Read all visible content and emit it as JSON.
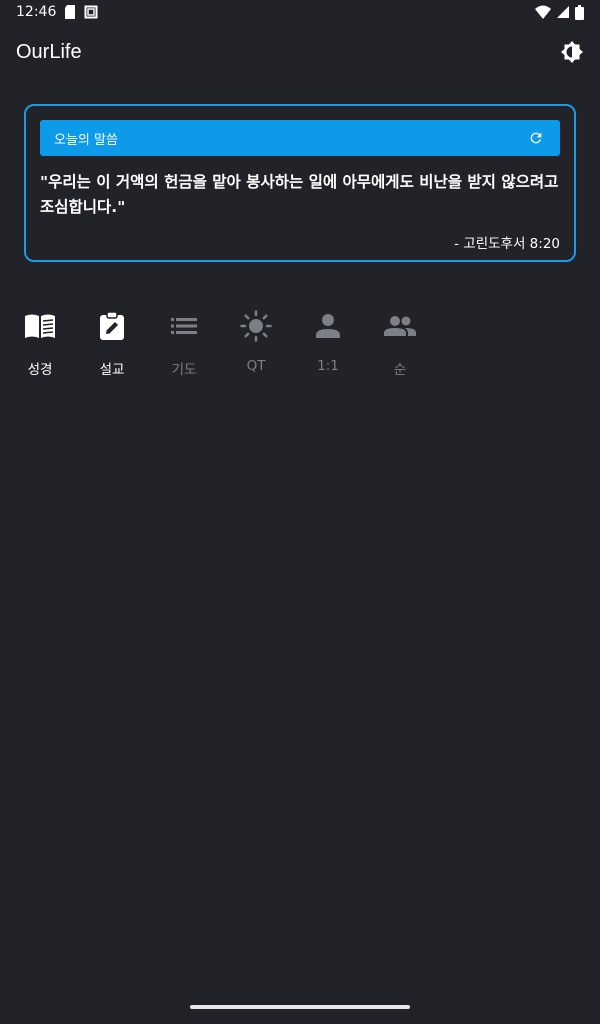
{
  "status_bar": {
    "time": "12:46"
  },
  "app_bar": {
    "title": "OurLife",
    "theme_icon": "brightness-icon"
  },
  "verse_card": {
    "header_title": "오늘의 말씀",
    "refresh_icon": "refresh-icon",
    "verse_text": "\"우리는 이 거액의 헌금을 맡아 봉사하는 일에 아무에게도 비난을 받지 않으려고 조심합니다.\"",
    "reference": "- 고린도후서 8:20",
    "accent_color": "#0d9ae8"
  },
  "menu": {
    "items": [
      {
        "label": "성경",
        "icon": "book-open-icon",
        "active": true
      },
      {
        "label": "설교",
        "icon": "sermon-edit-icon",
        "active": true
      },
      {
        "label": "기도",
        "icon": "list-icon",
        "active": false
      },
      {
        "label": "QT",
        "icon": "sun-icon",
        "active": false
      },
      {
        "label": "1:1",
        "icon": "person-icon",
        "active": false
      },
      {
        "label": "순",
        "icon": "people-icon",
        "active": false
      }
    ],
    "active_color": "#ffffff",
    "inactive_color": "#7c7f85"
  }
}
